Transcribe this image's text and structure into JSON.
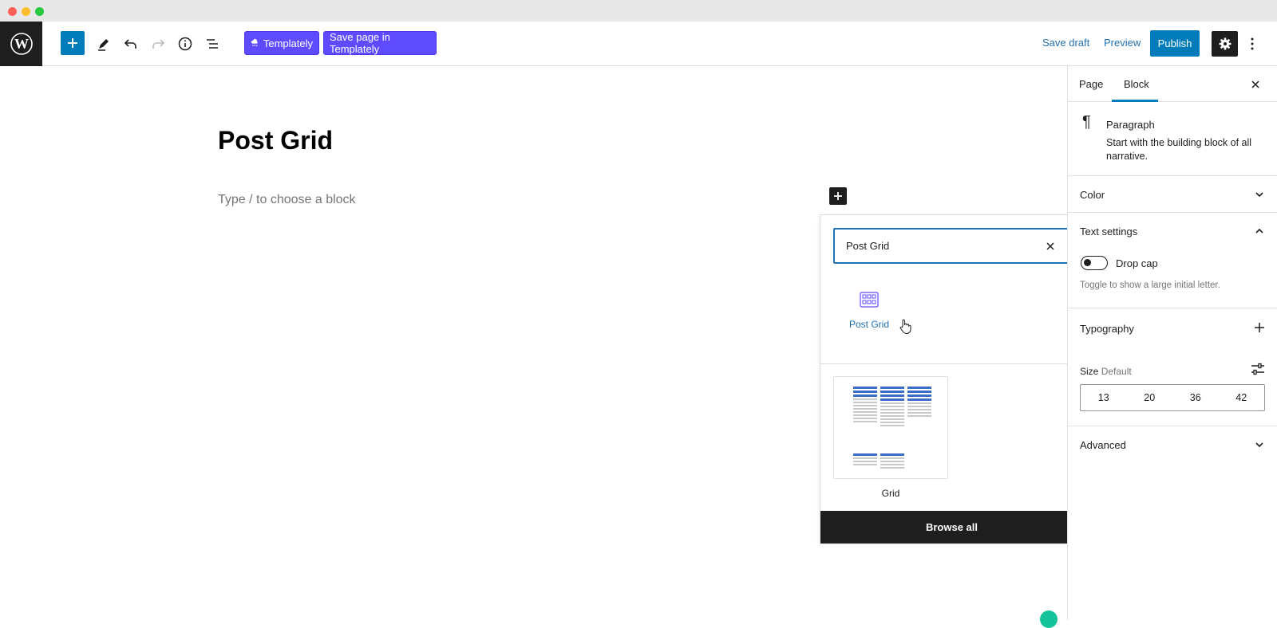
{
  "header": {
    "templately_label": "Templately",
    "save_templately_label": "Save page in Templately",
    "save_draft_label": "Save draft",
    "preview_label": "Preview",
    "publish_label": "Publish"
  },
  "canvas": {
    "title": "Post Grid",
    "placeholder": "Type / to choose a block"
  },
  "inserter": {
    "search_value": "Post Grid",
    "result_label": "Post Grid",
    "pattern_label": "Grid",
    "browse_all_label": "Browse all"
  },
  "sidebar": {
    "tabs": [
      {
        "label": "Page"
      },
      {
        "label": "Block"
      }
    ],
    "active_tab": "Block",
    "block": {
      "name": "Paragraph",
      "description": "Start with the building block of all narrative."
    },
    "panels": {
      "color": "Color",
      "text_settings": "Text settings",
      "drop_cap_label": "Drop cap",
      "drop_cap_help": "Toggle to show a large initial letter.",
      "typography": "Typography",
      "size_label": "Size",
      "size_value": "Default",
      "size_options": [
        "13",
        "20",
        "36",
        "42"
      ],
      "advanced": "Advanced"
    }
  },
  "colors": {
    "accent": "#007cba",
    "templately": "#5f4bff",
    "dark": "#1e1e1e"
  }
}
